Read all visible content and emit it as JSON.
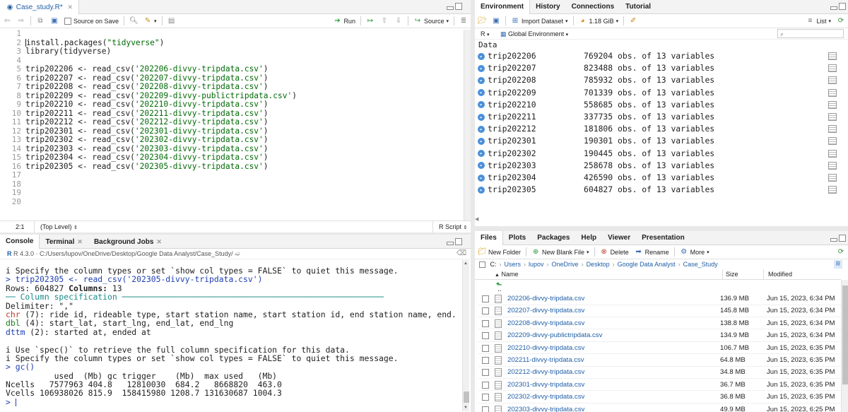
{
  "editor": {
    "file_tab": "Case_study.R*",
    "source_on_save": "Source on Save",
    "run": "Run",
    "source": "Source",
    "lines": [
      {
        "n": "1",
        "parts": []
      },
      {
        "n": "2",
        "parts": [
          {
            "t": "install.packages(",
            "c": "fn"
          },
          {
            "t": "\"tidyverse\"",
            "c": "str"
          },
          {
            "t": ")",
            "c": "fn"
          }
        ]
      },
      {
        "n": "3",
        "parts": [
          {
            "t": "library(tidyverse)",
            "c": "fn"
          }
        ]
      },
      {
        "n": "4",
        "parts": []
      },
      {
        "n": "5",
        "parts": [
          {
            "t": "trip202206 <- read_csv(",
            "c": "fn"
          },
          {
            "t": "'202206-divvy-tripdata.csv'",
            "c": "str"
          },
          {
            "t": ")",
            "c": "fn"
          }
        ]
      },
      {
        "n": "6",
        "parts": [
          {
            "t": "trip202207 <- read_csv(",
            "c": "fn"
          },
          {
            "t": "'202207-divvy-tripdata.csv'",
            "c": "str"
          },
          {
            "t": ")",
            "c": "fn"
          }
        ]
      },
      {
        "n": "7",
        "parts": [
          {
            "t": "trip202208 <- read_csv(",
            "c": "fn"
          },
          {
            "t": "'202208-divvy-tripdata.csv'",
            "c": "str"
          },
          {
            "t": ")",
            "c": "fn"
          }
        ]
      },
      {
        "n": "8",
        "parts": [
          {
            "t": "trip202209 <- read_csv(",
            "c": "fn"
          },
          {
            "t": "'202209-divvy-publictripdata.csv'",
            "c": "str"
          },
          {
            "t": ")",
            "c": "fn"
          }
        ]
      },
      {
        "n": "9",
        "parts": [
          {
            "t": "trip202210 <- read_csv(",
            "c": "fn"
          },
          {
            "t": "'202210-divvy-tripdata.csv'",
            "c": "str"
          },
          {
            "t": ")",
            "c": "fn"
          }
        ]
      },
      {
        "n": "10",
        "parts": [
          {
            "t": "trip202211 <- read_csv(",
            "c": "fn"
          },
          {
            "t": "'202211-divvy-tripdata.csv'",
            "c": "str"
          },
          {
            "t": ")",
            "c": "fn"
          }
        ]
      },
      {
        "n": "11",
        "parts": [
          {
            "t": "trip202212 <- read_csv(",
            "c": "fn"
          },
          {
            "t": "'202212-divvy-tripdata.csv'",
            "c": "str"
          },
          {
            "t": ")",
            "c": "fn"
          }
        ]
      },
      {
        "n": "12",
        "parts": [
          {
            "t": "trip202301 <- read_csv(",
            "c": "fn"
          },
          {
            "t": "'202301-divvy-tripdata.csv'",
            "c": "str"
          },
          {
            "t": ")",
            "c": "fn"
          }
        ]
      },
      {
        "n": "13",
        "parts": [
          {
            "t": "trip202302 <- read_csv(",
            "c": "fn"
          },
          {
            "t": "'202302-divvy-tripdata.csv'",
            "c": "str"
          },
          {
            "t": ")",
            "c": "fn"
          }
        ]
      },
      {
        "n": "14",
        "parts": [
          {
            "t": "trip202303 <- read_csv(",
            "c": "fn"
          },
          {
            "t": "'202303-divvy-tripdata.csv'",
            "c": "str"
          },
          {
            "t": ")",
            "c": "fn"
          }
        ]
      },
      {
        "n": "15",
        "parts": [
          {
            "t": "trip202304 <- read_csv(",
            "c": "fn"
          },
          {
            "t": "'202304-divvy-tripdata.csv'",
            "c": "str"
          },
          {
            "t": ")",
            "c": "fn"
          }
        ]
      },
      {
        "n": "16",
        "parts": [
          {
            "t": "trip202305 <- read_csv(",
            "c": "fn"
          },
          {
            "t": "'202305-divvy-tripdata.csv'",
            "c": "str"
          },
          {
            "t": ")",
            "c": "fn"
          }
        ]
      },
      {
        "n": "17",
        "parts": []
      },
      {
        "n": "18",
        "parts": []
      },
      {
        "n": "19",
        "parts": []
      },
      {
        "n": "20",
        "parts": []
      }
    ],
    "status_pos": "2:1",
    "status_scope": "(Top Level)",
    "status_type": "R Script"
  },
  "console": {
    "tabs": [
      "Console",
      "Terminal",
      "Background Jobs"
    ],
    "path": "R 4.3.0 · C:/Users/lupov/OneDrive/Desktop/Google Data Analyst/Case_Study/",
    "lines": [
      {
        "parts": [
          {
            "t": "i Specify the column types or set `show_col_types = FALSE` to quiet this message.",
            "c": "#222"
          }
        ]
      },
      {
        "parts": [
          {
            "t": "> trip202305 <- read_csv('202305-divvy-tripdata.csv')",
            "c": "#1f3fb5"
          }
        ]
      },
      {
        "parts": [
          {
            "t": "Rows: ",
            "c": "#222"
          },
          {
            "t": "604827",
            "c": "#222"
          },
          {
            "t": " Columns: ",
            "c": "#222",
            "b": true
          },
          {
            "t": "13",
            "c": "#222"
          }
        ]
      },
      {
        "parts": [
          {
            "t": "── Column specification ──────────────────────────────────────────────────────",
            "c": "#1a8a8a"
          }
        ]
      },
      {
        "parts": [
          {
            "t": "Delimiter: \",\"",
            "c": "#222"
          }
        ]
      },
      {
        "parts": [
          {
            "t": "chr",
            "c": "#c0392b"
          },
          {
            "t": " (7): ride_id, rideable_type, start_station_name, start_station_id, end_station_name, end...",
            "c": "#222"
          }
        ]
      },
      {
        "parts": [
          {
            "t": "dbl",
            "c": "#1a7a1a"
          },
          {
            "t": " (4): start_lat, start_lng, end_lat, end_lng",
            "c": "#222"
          }
        ]
      },
      {
        "parts": [
          {
            "t": "dttm",
            "c": "#1f3fb5"
          },
          {
            "t": " (2): started_at, ended_at",
            "c": "#222"
          }
        ]
      },
      {
        "parts": []
      },
      {
        "parts": [
          {
            "t": "i Use `spec()` to retrieve the full column specification for this data.",
            "c": "#222"
          }
        ]
      },
      {
        "parts": [
          {
            "t": "i Specify the column types or set `show_col_types = FALSE` to quiet this message.",
            "c": "#222"
          }
        ]
      },
      {
        "parts": [
          {
            "t": "> gc()",
            "c": "#1f3fb5"
          }
        ]
      },
      {
        "parts": [
          {
            "t": "          used  (Mb) gc trigger    (Mb)  max used   (Mb)",
            "c": "#222"
          }
        ]
      },
      {
        "parts": [
          {
            "t": "Ncells   7577963 404.8   12810030  684.2   8668820  463.0",
            "c": "#222"
          }
        ]
      },
      {
        "parts": [
          {
            "t": "Vcells 106938026 815.9  158415980 1208.7 131630687 1004.3",
            "c": "#222"
          }
        ]
      },
      {
        "parts": [
          {
            "t": "> ",
            "c": "#1f3fb5"
          }
        ]
      }
    ]
  },
  "environment": {
    "tabs": [
      "Environment",
      "History",
      "Connections",
      "Tutorial"
    ],
    "import_dataset": "Import Dataset",
    "memory": "1.18 GiB",
    "list_view": "List",
    "r_label": "R",
    "scope": "Global Environment",
    "section": "Data",
    "rows": [
      {
        "name": "trip202206",
        "value": "769204 obs. of 13 variables"
      },
      {
        "name": "trip202207",
        "value": "823488 obs. of 13 variables"
      },
      {
        "name": "trip202208",
        "value": "785932 obs. of 13 variables"
      },
      {
        "name": "trip202209",
        "value": "701339 obs. of 13 variables"
      },
      {
        "name": "trip202210",
        "value": "558685 obs. of 13 variables"
      },
      {
        "name": "trip202211",
        "value": "337735 obs. of 13 variables"
      },
      {
        "name": "trip202212",
        "value": "181806 obs. of 13 variables"
      },
      {
        "name": "trip202301",
        "value": "190301 obs. of 13 variables"
      },
      {
        "name": "trip202302",
        "value": "190445 obs. of 13 variables"
      },
      {
        "name": "trip202303",
        "value": "258678 obs. of 13 variables"
      },
      {
        "name": "trip202304",
        "value": "426590 obs. of 13 variables"
      },
      {
        "name": "trip202305",
        "value": "604827 obs. of 13 variables"
      }
    ]
  },
  "files": {
    "tabs": [
      "Files",
      "Plots",
      "Packages",
      "Help",
      "Viewer",
      "Presentation"
    ],
    "new_folder": "New Folder",
    "new_blank_file": "New Blank File",
    "delete": "Delete",
    "rename": "Rename",
    "more": "More",
    "breadcrumb": [
      "C:",
      "Users",
      "lupov",
      "OneDrive",
      "Desktop",
      "Google Data Analyst",
      "Case_Study"
    ],
    "col_name": "Name",
    "col_size": "Size",
    "col_modified": "Modified",
    "up": "..",
    "rows": [
      {
        "name": "202206-divvy-tripdata.csv",
        "size": "136.9 MB",
        "modified": "Jun 15, 2023, 6:34 PM"
      },
      {
        "name": "202207-divvy-tripdata.csv",
        "size": "145.8 MB",
        "modified": "Jun 15, 2023, 6:34 PM"
      },
      {
        "name": "202208-divvy-tripdata.csv",
        "size": "138.8 MB",
        "modified": "Jun 15, 2023, 6:34 PM"
      },
      {
        "name": "202209-divvy-publictripdata.csv",
        "size": "134.9 MB",
        "modified": "Jun 15, 2023, 6:34 PM"
      },
      {
        "name": "202210-divvy-tripdata.csv",
        "size": "106.7 MB",
        "modified": "Jun 15, 2023, 6:35 PM"
      },
      {
        "name": "202211-divvy-tripdata.csv",
        "size": "64.8 MB",
        "modified": "Jun 15, 2023, 6:35 PM"
      },
      {
        "name": "202212-divvy-tripdata.csv",
        "size": "34.8 MB",
        "modified": "Jun 15, 2023, 6:35 PM"
      },
      {
        "name": "202301-divvy-tripdata.csv",
        "size": "36.7 MB",
        "modified": "Jun 15, 2023, 6:35 PM"
      },
      {
        "name": "202302-divvy-tripdata.csv",
        "size": "36.8 MB",
        "modified": "Jun 15, 2023, 6:35 PM"
      },
      {
        "name": "202303-divvy-tripdata.csv",
        "size": "49.9 MB",
        "modified": "Jun 15, 2023, 6:25 PM"
      }
    ]
  }
}
